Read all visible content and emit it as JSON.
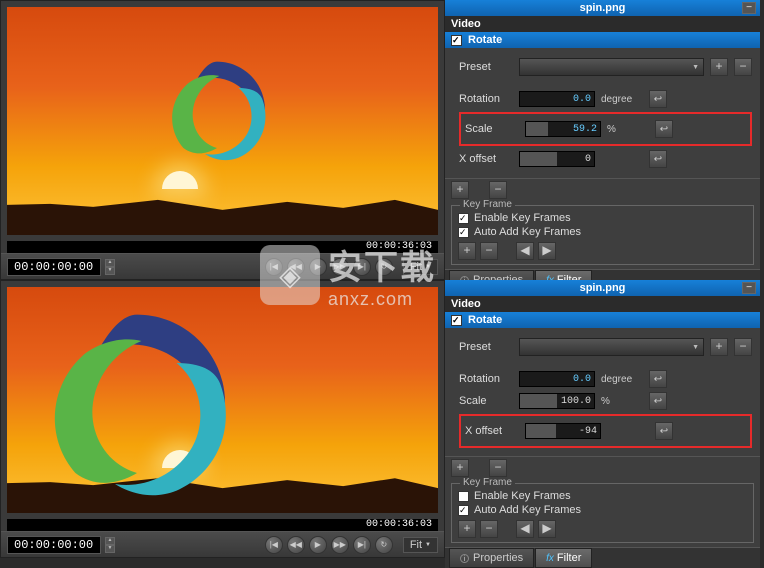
{
  "inspector": {
    "title": "spin.png",
    "section_video": "Video",
    "rotate_label": "Rotate",
    "preset_label": "Preset",
    "rotation_label": "Rotation",
    "scale_label": "Scale",
    "xoffset_label": "X offset",
    "unit_degree": "degree",
    "unit_percent": "%"
  },
  "top": {
    "rotation_value": "0.0",
    "scale_value": "59.2",
    "xoffset_value": "0",
    "timecode_bar": "00:00:36:03",
    "timecode": "00:00:00:00"
  },
  "bottom": {
    "rotation_value": "0.0",
    "scale_value": "100.0",
    "xoffset_value": "-94",
    "timecode_bar": "00:00:36:03",
    "timecode": "00:00:00:00"
  },
  "keyframe": {
    "legend": "Key Frame",
    "enable": "Enable Key Frames",
    "auto": "Auto Add Key Frames"
  },
  "transport": {
    "fit": "Fit"
  },
  "tabs": {
    "properties": "Properties",
    "filter": "Filter"
  },
  "watermark": {
    "cn": "安下载",
    "en": "anxz.com"
  }
}
